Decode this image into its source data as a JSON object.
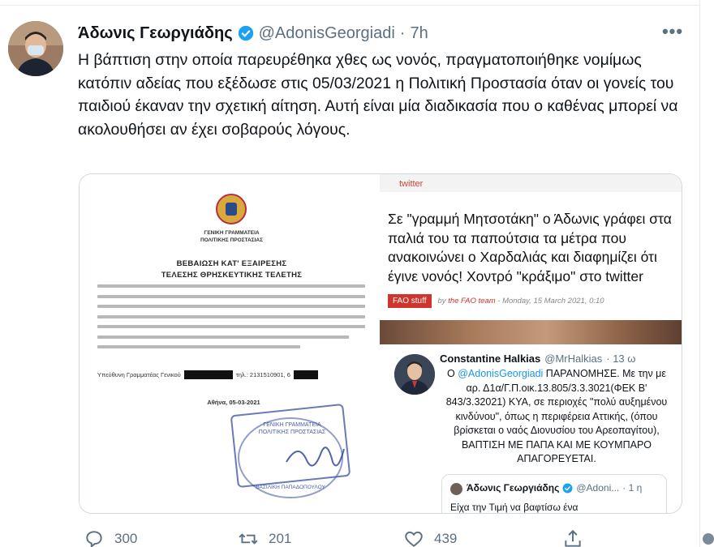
{
  "tweet": {
    "author_name": "Άδωνις Γεωργιάδης",
    "author_handle": "@AdonisGeorgiadi",
    "separator": "·",
    "time": "7h",
    "more_label": "•••",
    "text": "Η βάπτιση στην οποία παρευρέθηκα χθες ως νονός, πραγματοποιήθηκε νομίμως κατόπιν αδείας που εξέδωσε στις 05/03/2021 η Πολιτική Προστασία όταν οι γονείς του παιδιού έκαναν την σχετική αίτηση. Αυτή είναι μία διαδικασία που ο καθένας μπορεί να ακολουθήσει αν έχει σοβαρούς λόγους."
  },
  "document": {
    "org_line1": "ΓΕΝΙΚΗ ΓΡΑΜΜΑΤΕΙΑ",
    "org_line2": "ΠΟΛΙΤΙΚΗΣ ΠΡΟΣΤΑΣΙΑΣ",
    "title_line1": "ΒΕΒΑΙΩΣΗ ΚΑΤ' ΕΞΑΙΡΕΣΗΣ",
    "title_line2": "ΤΕΛΕΣΗΣ ΘΡΗΣΚΕΥΤΙΚΗΣ ΤΕΛΕΤΗΣ",
    "signer_label": "Υπεύθυνη Γραμματέας Γενικού",
    "phone_label": "τηλ.: 2131510901, 6",
    "date": "Αθήνα, 05-03-2021",
    "stamp_line1": "ΓΕΝΙΚΗ ΓΡΑΜΜΑΤΕΙΑ",
    "stamp_line2": "ΠΟΛΙΤΙΚΗΣ ΠΡΟΣΤΑΣΙΑΣ",
    "stamp_name": "ΒΑΣΙΛΙΚΗ ΠΑΠΑΔΟΠΟΥΛΟΥ"
  },
  "news": {
    "tag": "twitter",
    "headline": "Σε \"γραμμή Μητσοτάκη\" ο Άδωνις γράφει στα παλιά του τα παπούτσια τα μέτρα που ανακοινώνει ο Χαρδαλιάς και διαφημίζει ότι έγινε νονός! Χοντρό \"κράξιμο\" στο twitter",
    "badge": "FAO stuff",
    "byline_prefix": "by",
    "byline_team": "the FAO team",
    "byline_date": " - Monday, 15 March 2021, 0:10"
  },
  "quoted": {
    "name": "Constantine Halkias",
    "handle": "@MrHalkias",
    "time": "· 13 ω",
    "text_prefix": "Ο ",
    "mention": "@AdonisGeorgiadi",
    "text_rest": " ΠΑΡΑΝΟΜΗΣΕ. Με την με αρ. Δ1α/Γ.Π.οικ.13.805/3.3.3021(ΦΕΚ Β' 843/3.32021) ΚΥΑ, σε περιοχές \"πολύ αυξημένου κινδύνου\", όπως η περιφέρεια Αττικής, (όπου βρίσκεται ο ναός Διονυσίου του Αρεοπαγίτου), ΒΑΠΤΙΣΗ ΜΕ ΠΑΠΑ ΚΑΙ ΜΕ ΚΟΥΜΠΑΡΟ ΑΠΑΓΟΡΕΥΕΤΑΙ."
  },
  "nested": {
    "name": "Άδωνις Γεωργιάδης",
    "handle": "@Adoni...",
    "time": "· 1 η",
    "text": "Είχα την Τιμή να βαφτίσω ένα"
  },
  "actions": {
    "replies": "300",
    "retweets": "201",
    "likes": "439"
  },
  "colors": {
    "verified": "#1da1f2",
    "muted": "#5b7083",
    "badge_red": "#d0342c"
  }
}
